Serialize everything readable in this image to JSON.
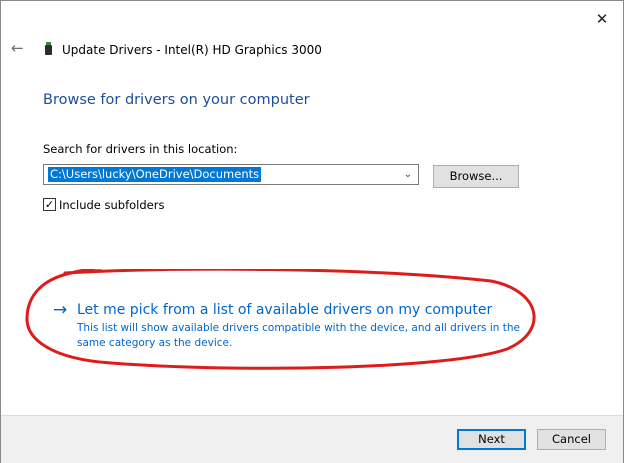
{
  "window": {
    "title": "Update Drivers - Intel(R) HD Graphics 3000",
    "close_glyph": "✕",
    "back_glyph": "←",
    "device_icon": "graphics-card-icon"
  },
  "main": {
    "heading": "Browse for drivers on your computer",
    "search_label": "Search for drivers in this location:",
    "path_value": "C:\\Users\\lucky\\OneDrive\\Documents",
    "chevron_glyph": "⌄",
    "browse_label": "Browse...",
    "include_subfolders_label": "Include subfolders",
    "include_subfolders_checked": true,
    "check_glyph": "✓",
    "pick_arrow_glyph": "→",
    "pick_title": "Let me pick from a list of available drivers on my computer",
    "pick_desc": "This list will show available drivers compatible with the device, and all drivers in the same category as the device."
  },
  "footer": {
    "next_label": "Next",
    "cancel_label": "Cancel"
  },
  "colors": {
    "heading": "#1e4d9a",
    "link": "#0066cc",
    "selection": "#0078d7",
    "annotation": "#e01b1b"
  }
}
